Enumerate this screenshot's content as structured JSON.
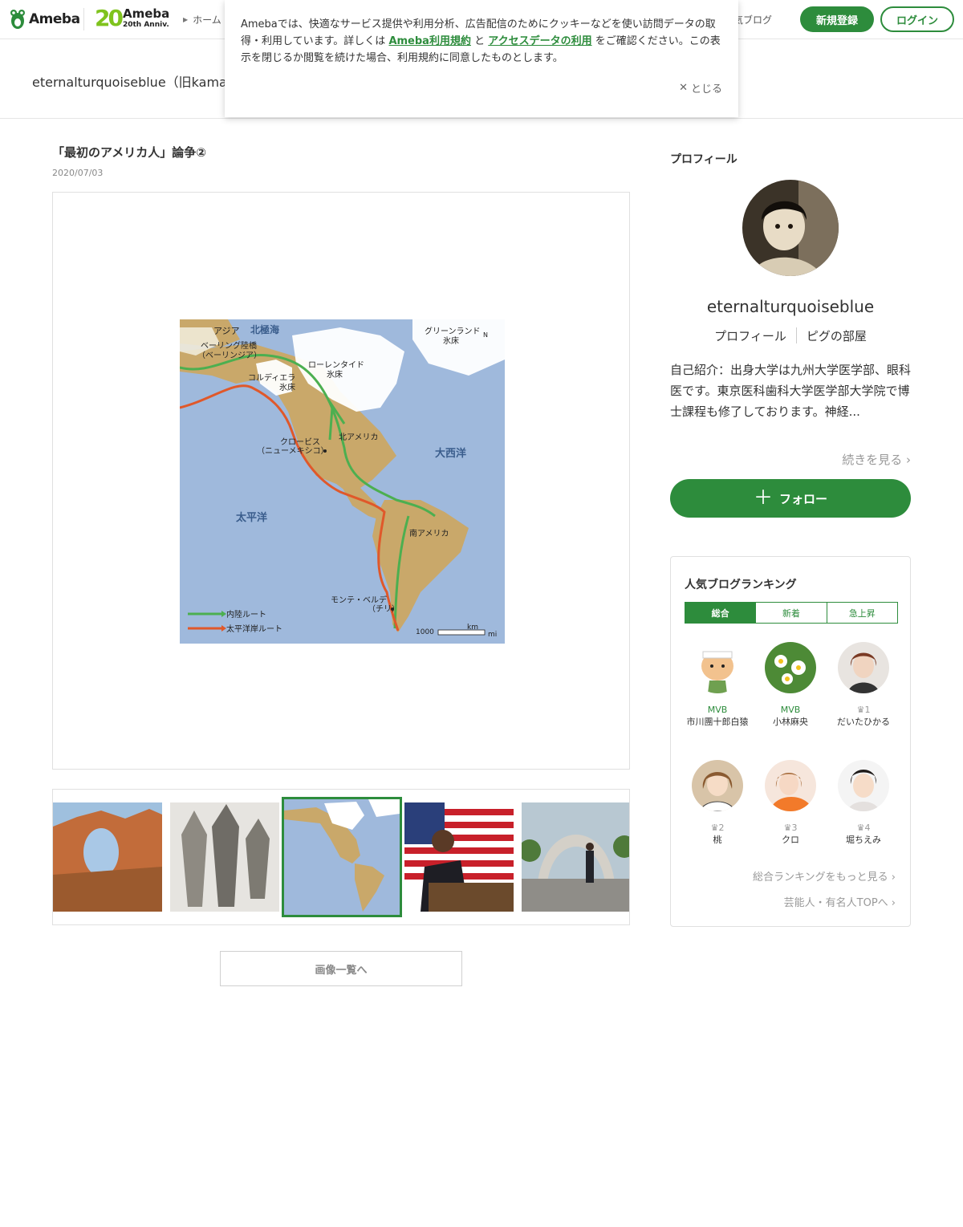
{
  "header": {
    "logo_text": "Ameba",
    "anniv_number": "20",
    "anniv_brand": "Ameba",
    "anniv_sub": "20th Anniv.",
    "breadcrumb_home": "ホーム",
    "popular_blog": "気ブログ",
    "register_label": "新規登録",
    "login_label": "ログイン"
  },
  "blog": {
    "title": "eternalturquoiseblue（旧kamak"
  },
  "cookie": {
    "text_1": "Amebaでは、快適なサービス提供や利用分析、広告配信のためにクッキーなどを使い訪問データの取得・利用しています。詳しくは",
    "link_terms": "Ameba利用規約",
    "text_and": "と",
    "link_access": "アクセスデータの利用",
    "text_2": "をご確認ください。この表示を閉じるか閲覧を続けた場合、利用規約に同意したものとします。",
    "close_label": "とじる"
  },
  "article": {
    "title": "「最初のアメリカ人」論争②",
    "date": "2020/07/03"
  },
  "map": {
    "labels": {
      "asia": "アジア",
      "arctic": "北極海",
      "beringia_1": "ベーリング陸橋",
      "beringia_2": "（ベーリンジア）",
      "greenland_1": "グリーンランド",
      "greenland_2": "氷床",
      "laurentide_1": "ローレンタイド",
      "laurentide_2": "氷床",
      "cordillera_1": "コルディエラ",
      "cordillera_2": "氷床",
      "north_america": "北アメリカ",
      "clovis_1": "クロービス",
      "clovis_2": "（ニューメキシコ）",
      "atlantic": "大西洋",
      "pacific": "太平洋",
      "south_america": "南アメリカ",
      "monte_verde_1": "モンテ・ベルデ",
      "monte_verde_2": "（チリ）",
      "legend_inland": "内陸ルート",
      "legend_coastal": "太平洋岸ルート",
      "scale_value": "1000",
      "scale_km": "km",
      "scale_mi": "mi",
      "north": "N"
    },
    "colors": {
      "ocean": "#9fb9dc",
      "land": "#c9a86a",
      "ice": "#ffffff",
      "inland_route": "#4caf50",
      "coastal_route": "#e0582a"
    }
  },
  "gallery": {
    "button_label": "画像一覧へ"
  },
  "sidebar": {
    "profile_heading": "プロフィール",
    "name": "eternalturquoiseblue",
    "link_profile": "プロフィール",
    "link_pig": "ピグの部屋",
    "bio": "自己紹介：出身大学は九州大学医学部、眼科医です。東京医科歯科大学医学部大学院で博士課程も修了しております。神経...",
    "readmore": "続きを見る",
    "follow_label": "フォロー"
  },
  "ranking": {
    "heading": "人気ブログランキング",
    "tabs": [
      "総合",
      "新着",
      "急上昇"
    ],
    "items": [
      {
        "badge": "MVB",
        "name": "市川團十郎白猿"
      },
      {
        "badge": "MVB",
        "name": "小林麻央"
      },
      {
        "badge": "1",
        "name": "だいたひかる"
      },
      {
        "badge": "2",
        "name": "桃"
      },
      {
        "badge": "3",
        "name": "クロ"
      },
      {
        "badge": "4",
        "name": "堀ちえみ"
      }
    ],
    "link_more": "総合ランキングをもっと見る",
    "link_celeb": "芸能人・有名人TOPへ"
  }
}
